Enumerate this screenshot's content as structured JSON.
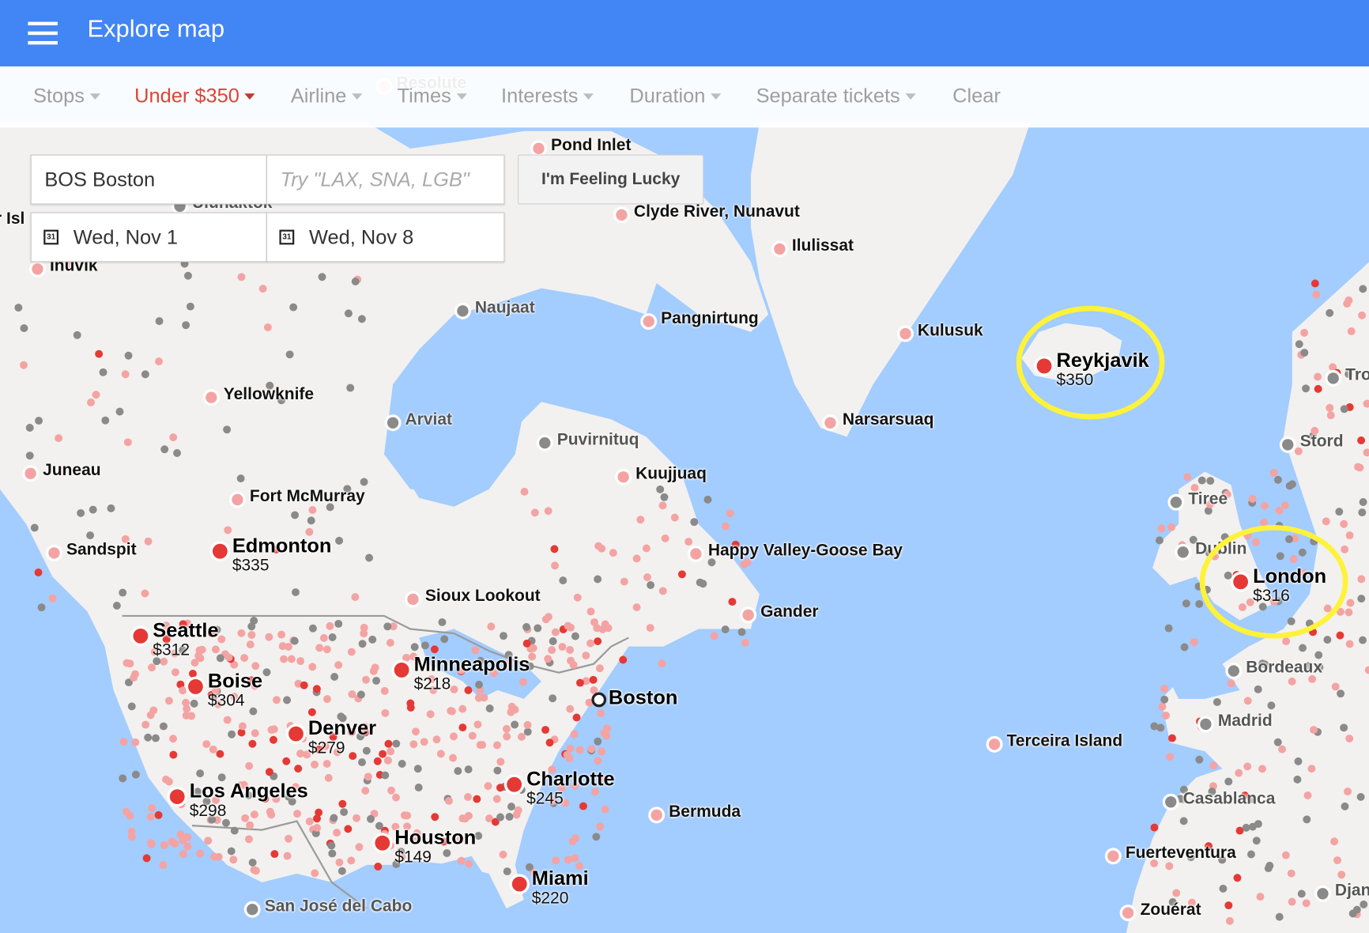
{
  "appbar": {
    "title": "Explore map",
    "menu_icon": "hamburger-menu-icon"
  },
  "filters": [
    {
      "label": "Stops",
      "active": false,
      "dropdown": true
    },
    {
      "label": "Under $350",
      "active": true,
      "dropdown": true
    },
    {
      "label": "Airline",
      "active": false,
      "dropdown": true
    },
    {
      "label": "Times",
      "active": false,
      "dropdown": true
    },
    {
      "label": "Interests",
      "active": false,
      "dropdown": true
    },
    {
      "label": "Duration",
      "active": false,
      "dropdown": true
    },
    {
      "label": "Separate tickets",
      "active": false,
      "dropdown": true
    },
    {
      "label": "Clear",
      "active": false,
      "dropdown": false
    }
  ],
  "search": {
    "origin_value": "BOS Boston",
    "destination_placeholder": "Try \"LAX, SNA, LGB\"",
    "depart_date": "Wed, Nov 1",
    "return_date": "Wed, Nov 8",
    "calendar_icon_text": "31",
    "lucky_button": "I'm Feeling Lucky"
  },
  "colors": {
    "appbar": "#4285f4",
    "active_filter": "#db4437",
    "water": "#a3ccff",
    "land": "#f2f1ef",
    "price_marker": "#e53935",
    "light_marker": "#f4a3a3",
    "gray_marker": "#8a8a8a",
    "highlight": "#fff23a"
  },
  "origin": {
    "name": "Boston"
  },
  "destinations_priced": [
    {
      "name": "Reykjavik",
      "price": "$350",
      "highlighted": true
    },
    {
      "name": "London",
      "price": "$316",
      "highlighted": true
    },
    {
      "name": "Edmonton",
      "price": "$335"
    },
    {
      "name": "Seattle",
      "price": "$312"
    },
    {
      "name": "Boise",
      "price": "$304"
    },
    {
      "name": "Minneapolis",
      "price": "$218"
    },
    {
      "name": "Denver",
      "price": "$279"
    },
    {
      "name": "Los Angeles",
      "price": "$298"
    },
    {
      "name": "Charlotte",
      "price": "$245"
    },
    {
      "name": "Houston",
      "price": "$149"
    },
    {
      "name": "Miami",
      "price": "$220"
    }
  ],
  "destinations_unpriced": [
    {
      "name": "Pond Inlet",
      "type": "light"
    },
    {
      "name": "Clyde River, Nunavut",
      "type": "light"
    },
    {
      "name": "Ilulissat",
      "type": "light"
    },
    {
      "name": "Inuvik",
      "type": "light"
    },
    {
      "name": "Uluhaktok",
      "type": "gray"
    },
    {
      "name": "Resolute",
      "type": "light"
    },
    {
      "name": "Naujaat",
      "type": "gray"
    },
    {
      "name": "Pangnirtung",
      "type": "light"
    },
    {
      "name": "Kulusuk",
      "type": "light"
    },
    {
      "name": "Yellowknife",
      "type": "light"
    },
    {
      "name": "Arviat",
      "type": "gray"
    },
    {
      "name": "Narsarsuaq",
      "type": "light"
    },
    {
      "name": "Puvirnituq",
      "type": "gray"
    },
    {
      "name": "Kuujjuaq",
      "type": "light"
    },
    {
      "name": "Juneau",
      "type": "light"
    },
    {
      "name": "Fort McMurray",
      "type": "light"
    },
    {
      "name": "Sandspit",
      "type": "light"
    },
    {
      "name": "Happy Valley-Goose Bay",
      "type": "light"
    },
    {
      "name": "Sioux Lookout",
      "type": "light"
    },
    {
      "name": "Gander",
      "type": "light"
    },
    {
      "name": "Terceira Island",
      "type": "light"
    },
    {
      "name": "Bermuda",
      "type": "light"
    },
    {
      "name": "San José del Cabo",
      "type": "gray"
    },
    {
      "name": "Tiree",
      "type": "gray"
    },
    {
      "name": "Dublin",
      "type": "gray"
    },
    {
      "name": "Stord",
      "type": "gray"
    },
    {
      "name": "Tro",
      "type": "gray"
    },
    {
      "name": "Bordeaux",
      "type": "gray"
    },
    {
      "name": "Madrid",
      "type": "gray"
    },
    {
      "name": "Casablanca",
      "type": "gray"
    },
    {
      "name": "Fuerteventura",
      "type": "light"
    },
    {
      "name": "Zouérat",
      "type": "light"
    },
    {
      "name": "Djan",
      "type": "gray"
    },
    {
      "name": "er Isl",
      "type": "label-only"
    }
  ]
}
